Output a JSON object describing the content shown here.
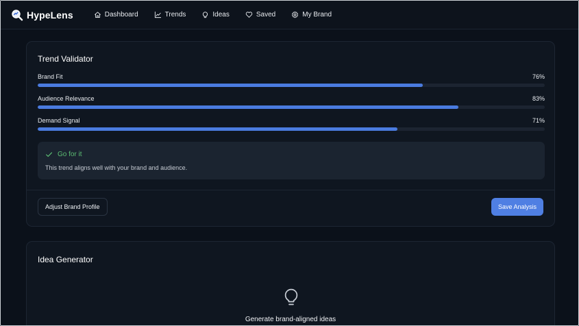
{
  "app": {
    "name": "HypeLens",
    "logo_icon": "magnifier-icon"
  },
  "nav": {
    "items": [
      {
        "label": "Dashboard",
        "icon": "home-icon"
      },
      {
        "label": "Trends",
        "icon": "chart-line-icon"
      },
      {
        "label": "Ideas",
        "icon": "lightbulb-icon"
      },
      {
        "label": "Saved",
        "icon": "heart-icon"
      },
      {
        "label": "My Brand",
        "icon": "gear-icon"
      }
    ]
  },
  "validator": {
    "title": "Trend Validator",
    "metrics": [
      {
        "label": "Brand Fit",
        "value": "76%",
        "fraction": 0.76
      },
      {
        "label": "Audience Relevance",
        "value": "83%",
        "fraction": 0.83
      },
      {
        "label": "Demand Signal",
        "value": "71%",
        "fraction": 0.71
      }
    ],
    "verdict": {
      "title": "Go for it",
      "text": "This trend aligns well with your brand and audience.",
      "icon": "check-icon"
    },
    "adjust_label": "Adjust Brand Profile",
    "save_label": "Save Analysis"
  },
  "generator": {
    "title": "Idea Generator",
    "empty_icon": "lightbulb-icon",
    "empty_title": "Generate brand-aligned ideas"
  },
  "colors": {
    "accent": "#4f7fe3",
    "bar_fill": "#4a7bdf",
    "success": "#5cbd73",
    "background": "#0b111a",
    "card": "#0f1620"
  }
}
